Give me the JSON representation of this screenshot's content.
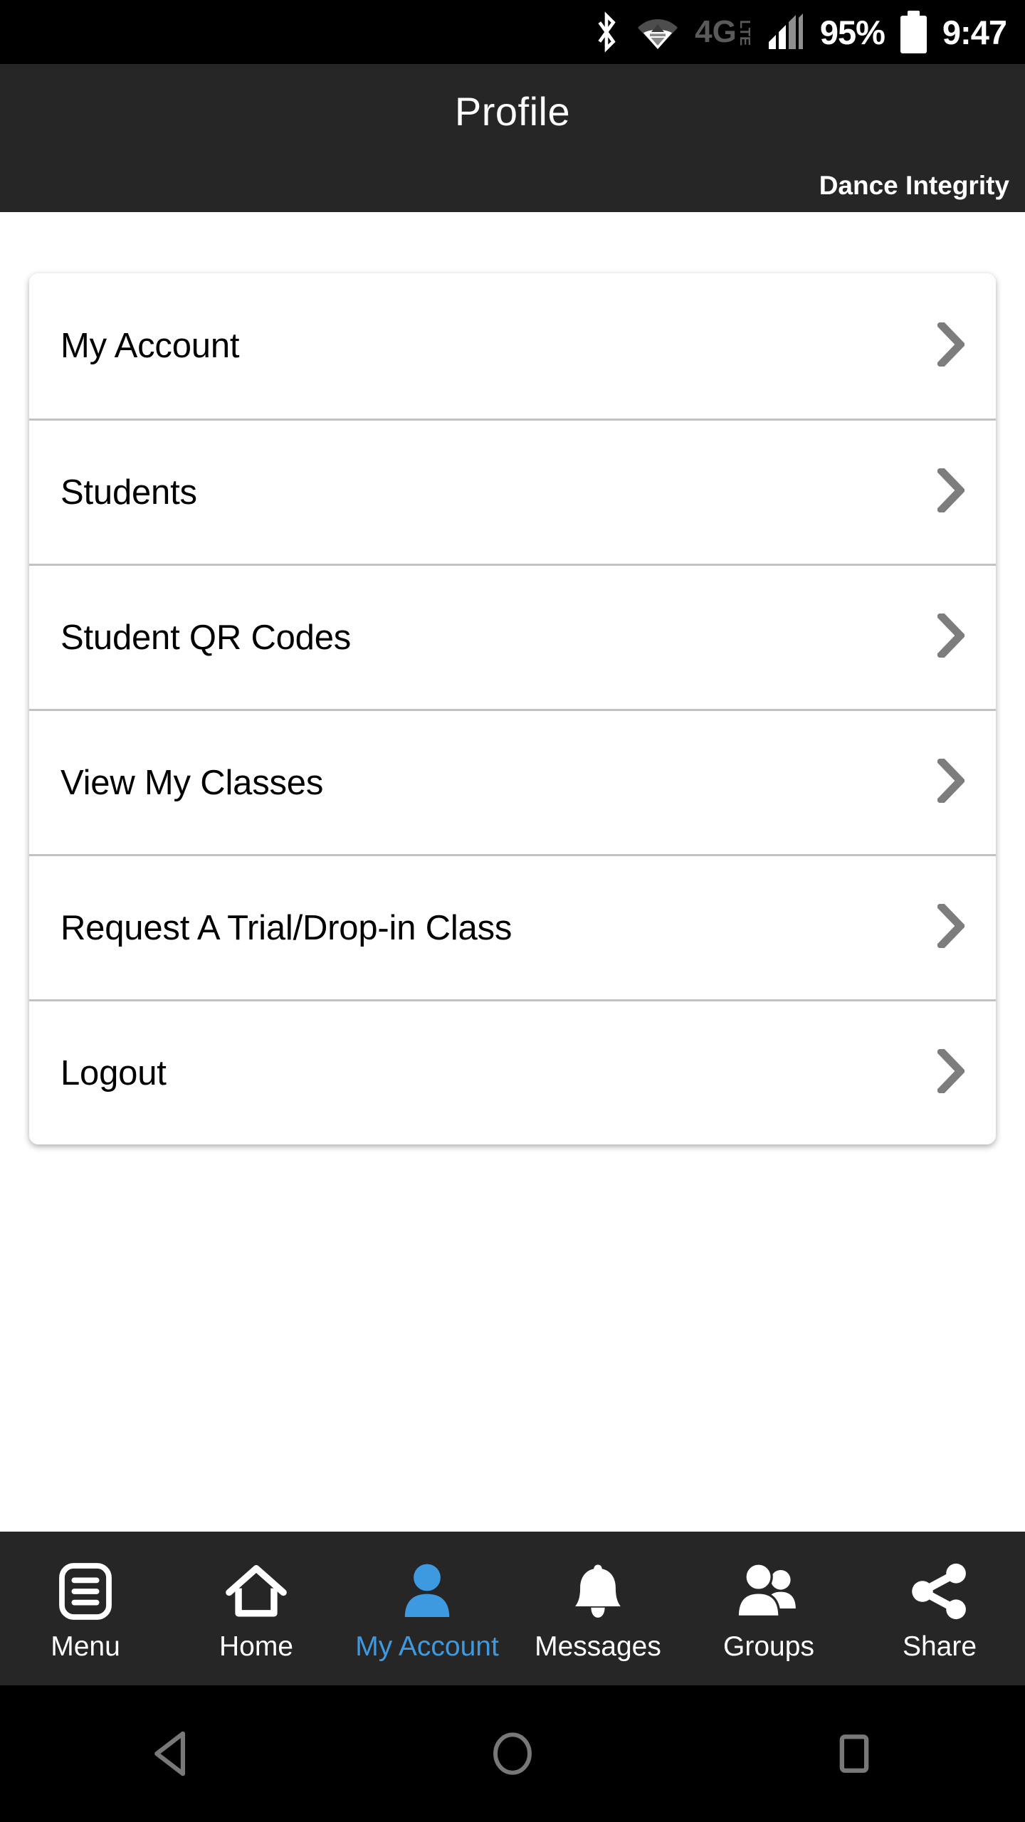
{
  "status_bar": {
    "bluetooth_icon": "bluetooth-icon",
    "wifi_icon": "wifi-icon",
    "network_type": "4G",
    "network_suffix": "LTE",
    "signal_icon": "signal-bars-icon",
    "battery_percent": "95%",
    "battery_icon": "battery-full-icon",
    "time": "9:47"
  },
  "header": {
    "title": "Profile",
    "org_name": "Dance Integrity"
  },
  "menu": {
    "chevron_icon": "chevron-right-icon",
    "chevron_color": "#7d7d7d",
    "items": [
      {
        "label": "My Account"
      },
      {
        "label": "Students"
      },
      {
        "label": "Student QR Codes"
      },
      {
        "label": "View My Classes"
      },
      {
        "label": "Request A Trial/Drop-in Class"
      },
      {
        "label": "Logout"
      }
    ]
  },
  "bottom_nav": {
    "active_color": "#3d9ae0",
    "inactive_color": "#ffffff",
    "background": "#262626",
    "items": [
      {
        "label": "Menu",
        "icon": "list-menu-icon",
        "active": false
      },
      {
        "label": "Home",
        "icon": "home-icon",
        "active": false
      },
      {
        "label": "My Account",
        "icon": "person-icon",
        "active": true
      },
      {
        "label": "Messages",
        "icon": "bell-icon",
        "active": false
      },
      {
        "label": "Groups",
        "icon": "people-group-icon",
        "active": false
      },
      {
        "label": "Share",
        "icon": "share-nodes-icon",
        "active": false
      }
    ]
  },
  "android_nav": {
    "back_icon": "back-triangle-icon",
    "home_icon": "home-circle-icon",
    "recents_icon": "recents-square-icon",
    "icon_color": "#787878"
  }
}
